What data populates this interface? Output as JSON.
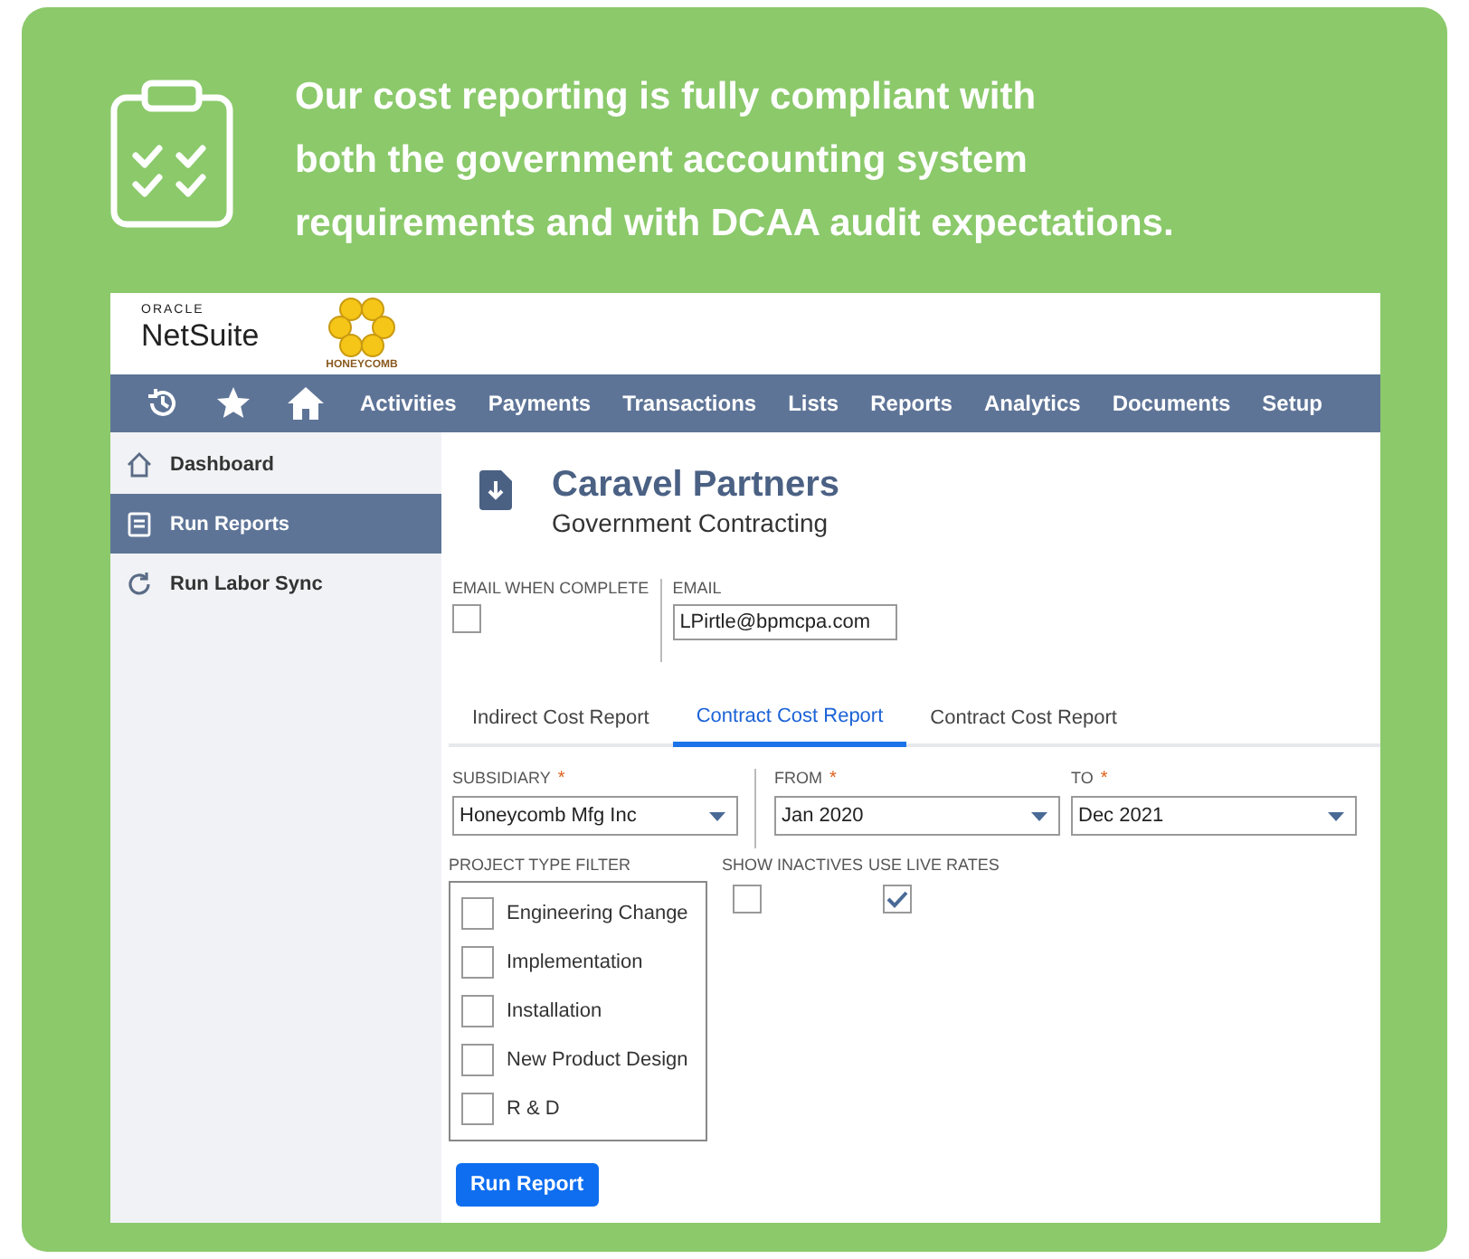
{
  "banner": {
    "text": "Our cost reporting is fully compliant with\nboth the government accounting system\nrequirements and with DCAA audit expectations."
  },
  "app": {
    "logo": {
      "oracle": "ORACLE",
      "netsuite": "NetSuite",
      "honeycomb": "HONEYCOMB"
    },
    "nav": [
      "Activities",
      "Payments",
      "Transactions",
      "Lists",
      "Reports",
      "Analytics",
      "Documents",
      "Setup"
    ],
    "sidebar": [
      {
        "label": "Dashboard",
        "selected": false
      },
      {
        "label": "Run Reports",
        "selected": true
      },
      {
        "label": "Run Labor Sync",
        "selected": false
      }
    ],
    "page": {
      "title": "Caravel Partners",
      "subtitle": "Government Contracting"
    },
    "email_when_complete": {
      "label": "EMAIL WHEN COMPLETE",
      "checked": false
    },
    "email": {
      "label": "EMAIL",
      "value": "LPirtle@bpmcpa.com"
    },
    "tabs": [
      {
        "label": "Indirect Cost Report",
        "selected": false
      },
      {
        "label": "Contract Cost Report",
        "selected": true
      },
      {
        "label": "Contract Cost Report",
        "selected": false
      }
    ],
    "subsidiary": {
      "label": "SUBSIDIARY",
      "required_mark": "*",
      "value": "Honeycomb Mfg Inc"
    },
    "from": {
      "label": "FROM",
      "required_mark": "*",
      "value": "Jan 2020"
    },
    "to": {
      "label": "TO",
      "required_mark": "*",
      "value": "Dec 2021"
    },
    "project_type_filter": {
      "label": "PROJECT TYPE FILTER",
      "options": [
        {
          "label": "Engineering Change",
          "checked": false
        },
        {
          "label": "Implementation",
          "checked": false
        },
        {
          "label": "Installation",
          "checked": false
        },
        {
          "label": "New Product Design",
          "checked": false
        },
        {
          "label": "R & D",
          "checked": false
        }
      ]
    },
    "show_inactives": {
      "label": "SHOW INACTIVES",
      "checked": false
    },
    "use_live_rates": {
      "label": "USE LIVE RATES",
      "checked": true
    },
    "run_button": "Run Report"
  }
}
